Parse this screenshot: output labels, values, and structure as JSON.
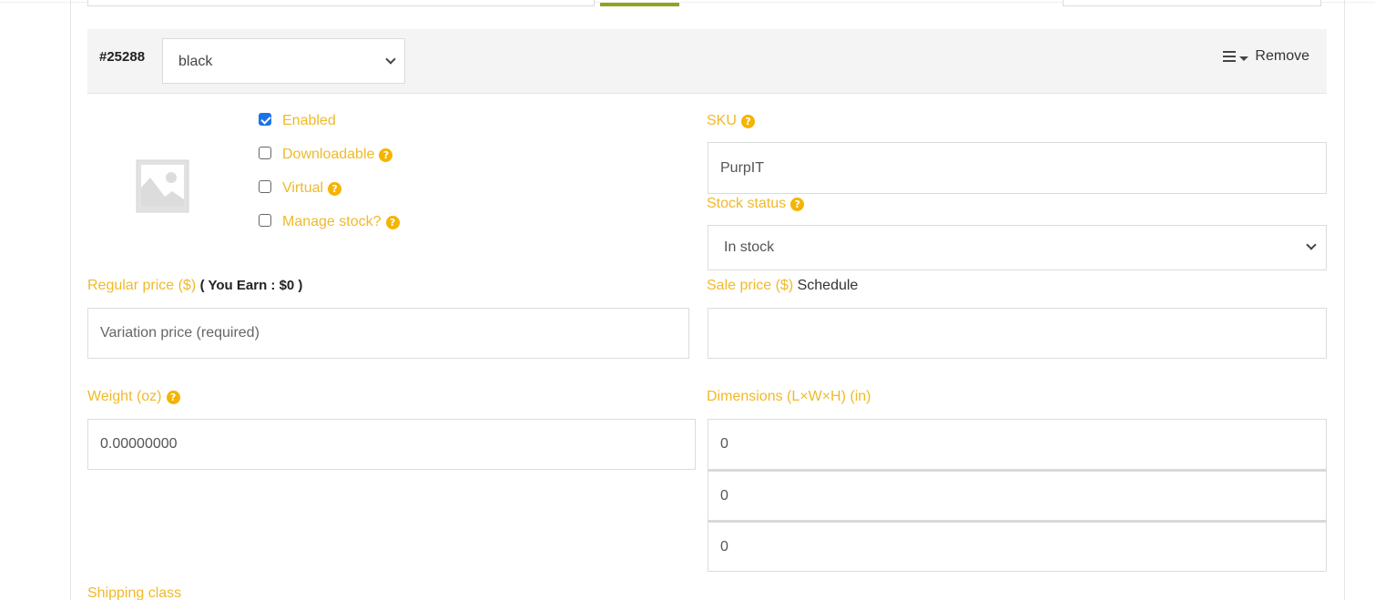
{
  "variation": {
    "id": "#25288",
    "attribute_value": "black",
    "actions": {
      "menu_icon": "hamburger-icon",
      "caret_icon": "caret-down-icon",
      "remove_label": "Remove"
    }
  },
  "image": {
    "icon": "image-placeholder-icon"
  },
  "options": [
    {
      "label": "Enabled",
      "checked": true,
      "help": false
    },
    {
      "label": "Downloadable",
      "checked": false,
      "help": true
    },
    {
      "label": "Virtual",
      "checked": false,
      "help": true
    },
    {
      "label": "Manage stock?",
      "checked": false,
      "help": true
    }
  ],
  "help_glyph": "?",
  "sku": {
    "label": "SKU",
    "value": "PurpIT"
  },
  "stock_status": {
    "label": "Stock status",
    "value": "In stock"
  },
  "regular_price": {
    "label": "Regular price ($)",
    "earn_note": "( You Earn : $0 )",
    "placeholder": "Variation price (required)",
    "value": ""
  },
  "sale_price": {
    "label": "Sale price ($)",
    "schedule_link": "Schedule",
    "value": ""
  },
  "weight": {
    "label": "Weight (oz)",
    "value": "0.00000000"
  },
  "dimensions": {
    "label": "Dimensions (L×W×H) (in)",
    "length": "0",
    "width": "0",
    "height": "0"
  },
  "shipping_class": {
    "label": "Shipping class"
  },
  "colors": {
    "label_amber": "#f0b929",
    "help_badge": "#f5b400",
    "checkbox_blue": "#1a73e8",
    "accent_green": "#8ea51f",
    "header_bg": "#f4f4f4"
  }
}
